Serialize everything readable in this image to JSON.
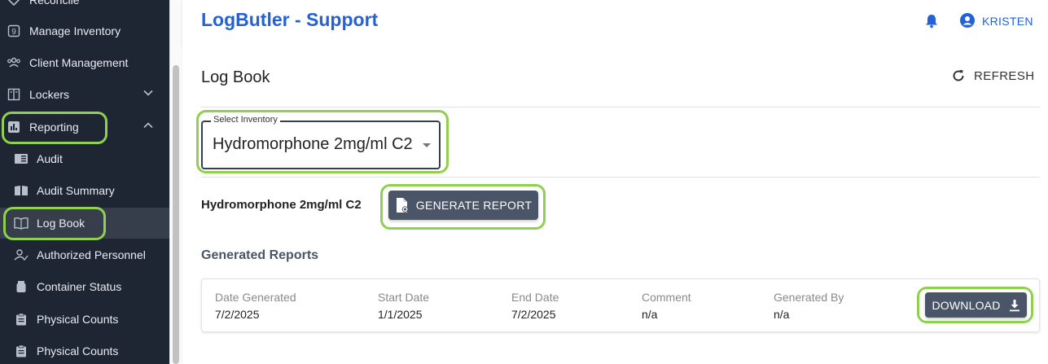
{
  "sidebar": {
    "items": [
      {
        "label": "Reconcile",
        "icon": "reconcile-icon"
      },
      {
        "label": "Manage Inventory",
        "icon": "inventory-icon"
      },
      {
        "label": "Client Management",
        "icon": "clients-icon"
      },
      {
        "label": "Lockers",
        "icon": "lockers-icon"
      },
      {
        "label": "Reporting",
        "icon": "reporting-icon"
      },
      {
        "label": "Audit",
        "icon": "audit-icon"
      },
      {
        "label": "Audit Summary",
        "icon": "audit-summary-icon"
      },
      {
        "label": "Log Book",
        "icon": "log-book-icon"
      },
      {
        "label": "Authorized Personnel",
        "icon": "authorized-personnel-icon"
      },
      {
        "label": "Container Status",
        "icon": "container-icon"
      },
      {
        "label": "Physical Counts",
        "icon": "clipboard-icon"
      },
      {
        "label": "Physical Counts",
        "icon": "clipboard-icon"
      }
    ]
  },
  "header": {
    "app_title": "LogButler - Support",
    "user_name": "KRISTEN"
  },
  "main": {
    "page_title": "Log Book",
    "refresh_label": "REFRESH",
    "select": {
      "legend": "Select Inventory",
      "value": "Hydromorphone 2mg/ml C2"
    },
    "inventory_label": "Hydromorphone 2mg/ml C2",
    "generate_label": "GENERATE REPORT",
    "section_title": "Generated Reports",
    "report": {
      "date_generated_label": "Date Generated",
      "date_generated": "7/2/2025",
      "start_date_label": "Start Date",
      "start_date": "1/1/2025",
      "end_date_label": "End Date",
      "end_date": "7/2/2025",
      "comment_label": "Comment",
      "comment": "n/a",
      "generated_by_label": "Generated By",
      "generated_by": "n/a",
      "download_label": "DOWNLOAD"
    }
  },
  "colors": {
    "sidebar_bg": "#1e2533",
    "brand_blue": "#2361d6",
    "button_bg": "#4a5568",
    "highlight_ring": "#8fd14f"
  }
}
